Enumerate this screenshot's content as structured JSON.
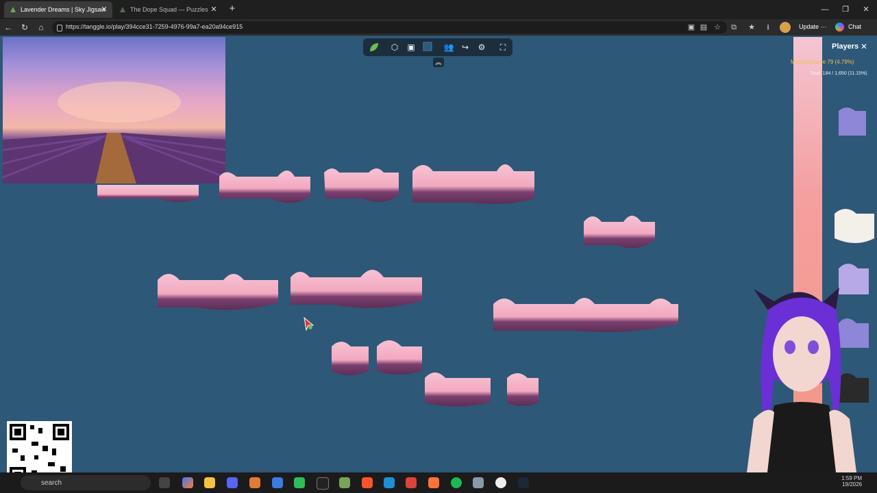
{
  "browser": {
    "tabs": [
      {
        "title": "Lavender Dreams | Sky Jigsaw",
        "active": true
      },
      {
        "title": "The Dope Squad — Puzzles",
        "active": false
      }
    ],
    "url": "https://tanggle.io/play/394cce31-7259-4976-99a7-ea20a94ce915",
    "update_label": "Update",
    "more_label": "···",
    "chat_label": "Chat"
  },
  "game": {
    "toolbar_icons": [
      "logo-leaf-icon",
      "puzzle-piece-icon",
      "image-preview-icon",
      "background-color-icon",
      "players-icon",
      "share-icon",
      "settings-icon",
      "fullscreen-icon"
    ],
    "background_color": "#2d5878",
    "players_panel": {
      "title": "Players",
      "player_name": "MsDopesauce",
      "player_stats": "79 (4.79%)",
      "total": "Total: 184 / 1,650 (11.15%)"
    }
  },
  "taskbar": {
    "search_placeholder": "search",
    "time": "1:59 PM",
    "date": "19/2026"
  }
}
